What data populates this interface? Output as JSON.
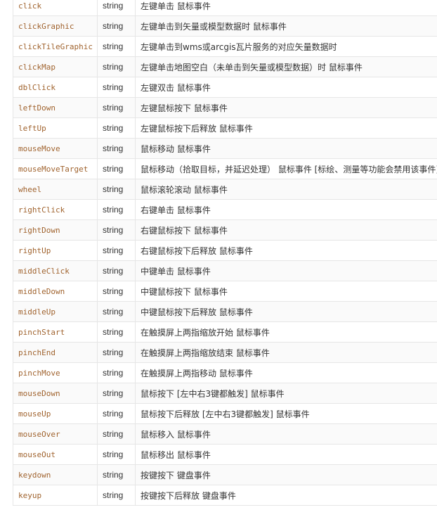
{
  "rows": [
    {
      "name": "click",
      "type": "string",
      "desc": "左键单击 鼠标事件"
    },
    {
      "name": "clickGraphic",
      "type": "string",
      "desc": "左键单击到矢量或模型数据时 鼠标事件"
    },
    {
      "name": "clickTileGraphic",
      "type": "string",
      "desc": "左键单击到wms或arcgis瓦片服务的对应矢量数据时"
    },
    {
      "name": "clickMap",
      "type": "string",
      "desc": "左键单击地图空白（未单击到矢量或模型数据）时 鼠标事件"
    },
    {
      "name": "dblClick",
      "type": "string",
      "desc": "左键双击 鼠标事件"
    },
    {
      "name": "leftDown",
      "type": "string",
      "desc": "左键鼠标按下 鼠标事件"
    },
    {
      "name": "leftUp",
      "type": "string",
      "desc": "左键鼠标按下后释放 鼠标事件"
    },
    {
      "name": "mouseMove",
      "type": "string",
      "desc": "鼠标移动 鼠标事件"
    },
    {
      "name": "mouseMoveTarget",
      "type": "string",
      "desc": "鼠标移动（拾取目标，并延迟处理） 鼠标事件 [标绘、测量等功能会禁用该事件]"
    },
    {
      "name": "wheel",
      "type": "string",
      "desc": "鼠标滚轮滚动 鼠标事件"
    },
    {
      "name": "rightClick",
      "type": "string",
      "desc": "右键单击 鼠标事件"
    },
    {
      "name": "rightDown",
      "type": "string",
      "desc": "右键鼠标按下 鼠标事件"
    },
    {
      "name": "rightUp",
      "type": "string",
      "desc": "右键鼠标按下后释放 鼠标事件"
    },
    {
      "name": "middleClick",
      "type": "string",
      "desc": "中键单击 鼠标事件"
    },
    {
      "name": "middleDown",
      "type": "string",
      "desc": "中键鼠标按下 鼠标事件"
    },
    {
      "name": "middleUp",
      "type": "string",
      "desc": "中键鼠标按下后释放 鼠标事件"
    },
    {
      "name": "pinchStart",
      "type": "string",
      "desc": "在触摸屏上两指缩放开始 鼠标事件"
    },
    {
      "name": "pinchEnd",
      "type": "string",
      "desc": "在触摸屏上两指缩放结束 鼠标事件"
    },
    {
      "name": "pinchMove",
      "type": "string",
      "desc": "在触摸屏上两指移动 鼠标事件"
    },
    {
      "name": "mouseDown",
      "type": "string",
      "desc": "鼠标按下 [左中右3键都触发] 鼠标事件"
    },
    {
      "name": "mouseUp",
      "type": "string",
      "desc": "鼠标按下后释放 [左中右3键都触发] 鼠标事件"
    },
    {
      "name": "mouseOver",
      "type": "string",
      "desc": "鼠标移入 鼠标事件"
    },
    {
      "name": "mouseOut",
      "type": "string",
      "desc": "鼠标移出 鼠标事件"
    },
    {
      "name": "keydown",
      "type": "string",
      "desc": "按键按下 键盘事件"
    },
    {
      "name": "keyup",
      "type": "string",
      "desc": "按键按下后释放 键盘事件"
    }
  ]
}
